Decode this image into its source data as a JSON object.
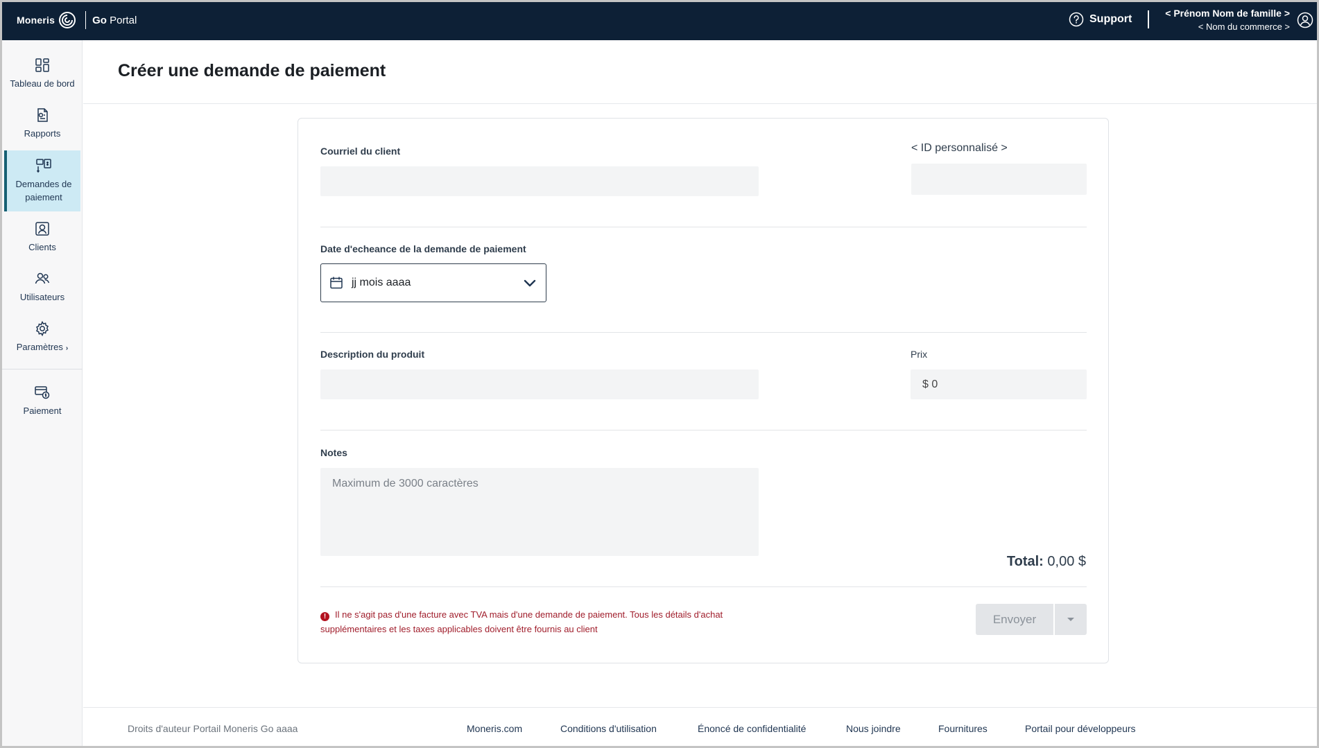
{
  "header": {
    "brand": "Moneris",
    "product_go": "Go",
    "product_portal": "Portal",
    "support_label": "Support",
    "user_name": "< Prénom Nom de famille >",
    "business_name": "< Nom du commerce >"
  },
  "sidebar": {
    "items": [
      {
        "label": "Tableau de bord",
        "icon": "dashboard-icon"
      },
      {
        "label": "Rapports",
        "icon": "reports-icon"
      },
      {
        "label": "Demandes de paiement",
        "icon": "payment-requests-icon",
        "active": true
      },
      {
        "label": "Clients",
        "icon": "clients-icon"
      },
      {
        "label": "Utilisateurs",
        "icon": "users-icon"
      },
      {
        "label": "Paramètres",
        "icon": "gear-icon"
      },
      {
        "label": "Paiement",
        "icon": "payment-icon"
      }
    ]
  },
  "page": {
    "title": "Créer une demande de paiement"
  },
  "form": {
    "email_label": "Courriel du client",
    "custom_id_label": "< ID personnalisé >",
    "due_date_label": "Date d'echeance de la demande de paiement",
    "due_date_placeholder": "jj mois aaaa",
    "description_label": "Description du produit",
    "price_label": "Prix",
    "price_value": "$ 0",
    "notes_label": "Notes",
    "notes_placeholder": "Maximum de 3000 caractères",
    "total_label": "Total:",
    "total_value": "0,00 $",
    "warning_text": "Il ne s'agit pas d'une facture avec TVA mais d'une demande de paiement. Tous les détails d'achat supplémentaires et les taxes applicables doivent être fournis au client",
    "send_label": "Envoyer"
  },
  "footer": {
    "copyright": "Droits d'auteur Portail Moneris Go  aaaa",
    "links": [
      "Moneris.com",
      "Conditions d'utilisation",
      "Énoncé de confidentialité",
      "Nous joindre",
      "Fournitures",
      "Portail pour développeurs"
    ]
  },
  "colors": {
    "topbar": "#0d2036",
    "active_nav": "#cdeaf4",
    "warning": "#a01d2b"
  }
}
